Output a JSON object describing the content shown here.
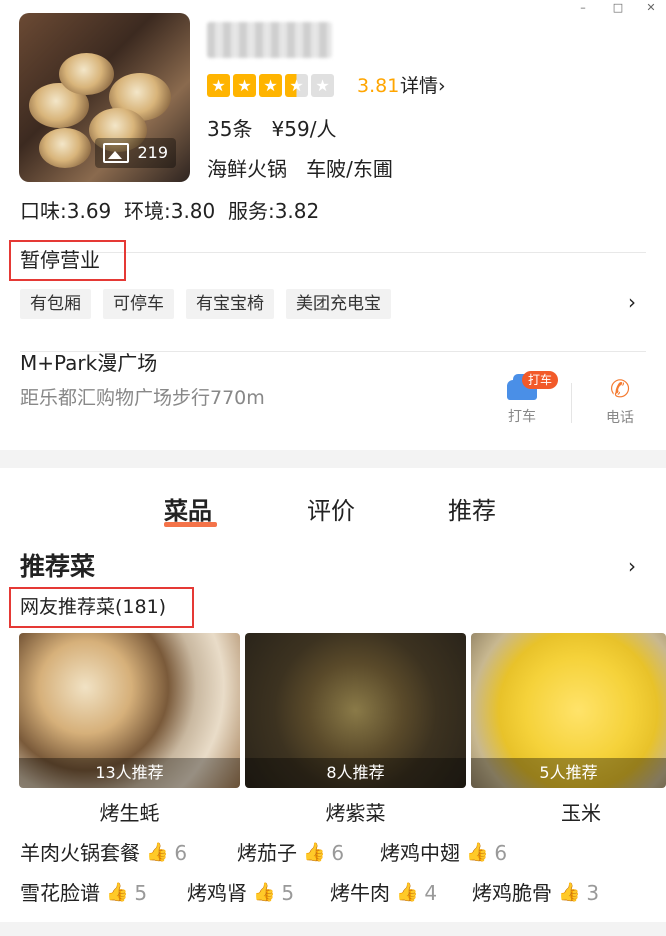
{
  "window": {
    "minimize_glyph": "–",
    "maximize_glyph": "□",
    "close_glyph": "✕"
  },
  "shop": {
    "photo_count": "219",
    "rating_value": "3.81",
    "rating_stars": 3.5,
    "detail_link": "详情",
    "reviews": "35条",
    "price": "¥59/人",
    "category": "海鲜火锅",
    "area": "车陂/东圃",
    "scores": "口味:3.69  环境:3.80  服务:3.82",
    "status": "暂停营业",
    "tags": [
      "有包厢",
      "可停车",
      "有宝宝椅",
      "美团充电宝"
    ],
    "address": "M+Park漫广场",
    "distance": "距乐都汇购物广场步行770m",
    "actions": {
      "taxi_label": "打车",
      "taxi_badge": "打车",
      "phone_label": "电话"
    }
  },
  "tabs": [
    "菜品",
    "评价",
    "推荐"
  ],
  "recommend": {
    "title": "推荐菜",
    "subtitle": "网友推荐菜(181)",
    "dishes": [
      {
        "label": "13人推荐",
        "name": "烤生蚝"
      },
      {
        "label": "8人推荐",
        "name": "烤紫菜"
      },
      {
        "label": "5人推荐",
        "name": "玉米"
      }
    ],
    "others": [
      {
        "name": "羊肉火锅套餐",
        "count": "6"
      },
      {
        "name": "烤茄子",
        "count": "6"
      },
      {
        "name": "烤鸡中翅",
        "count": "6"
      },
      {
        "name": "雪花脸谱",
        "count": "5"
      },
      {
        "name": "烤鸡肾",
        "count": "5"
      },
      {
        "name": "烤牛肉",
        "count": "4"
      },
      {
        "name": "烤鸡脆骨",
        "count": "3"
      }
    ]
  },
  "icons": [
    "image-icon",
    "star-icon",
    "chevron-right-icon",
    "taxi-icon",
    "phone-icon",
    "thumb-up-icon"
  ]
}
